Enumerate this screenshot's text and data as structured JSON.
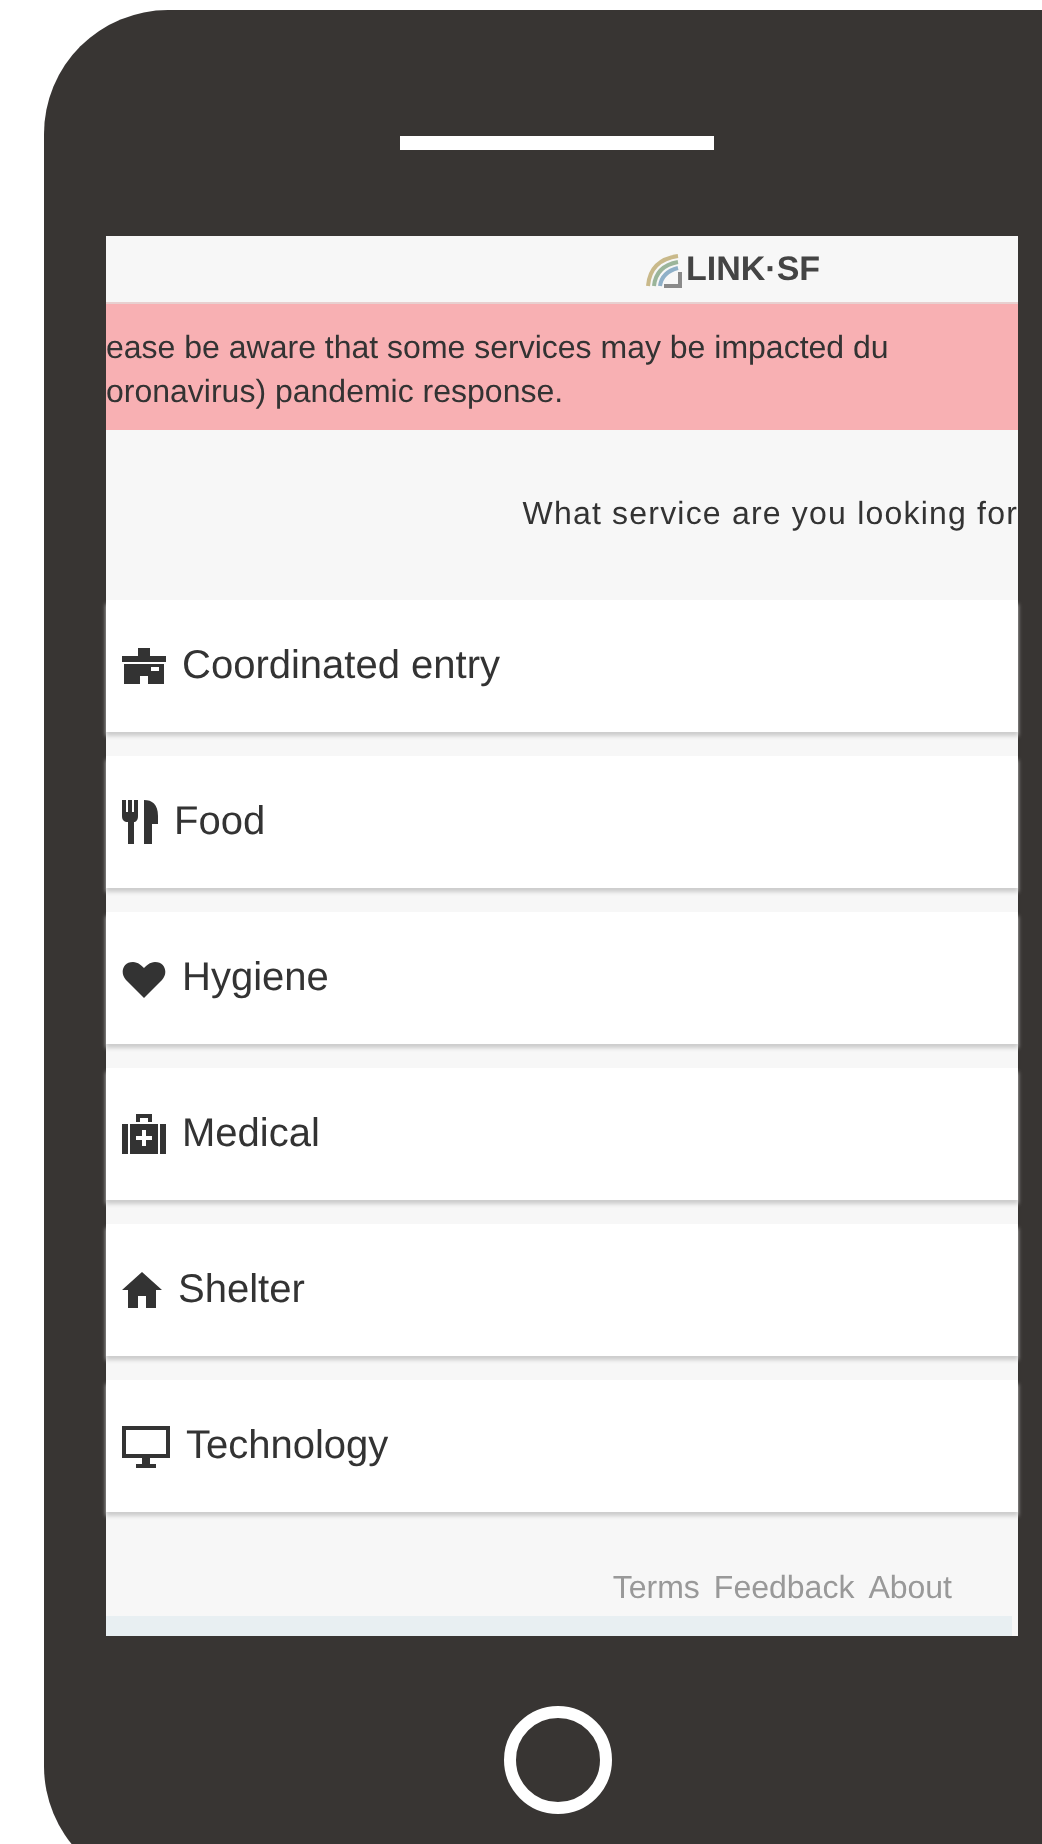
{
  "header": {
    "logo_text": "LINK·SF"
  },
  "alert": {
    "lines": [
      "ease be aware that some services may be impacted du",
      "oronavirus) pandemic response."
    ]
  },
  "prompt": "What service are you looking for",
  "services": [
    {
      "kind": "entry",
      "label": "Coordinated entry"
    },
    {
      "kind": "food",
      "label": "Food"
    },
    {
      "kind": "hygiene",
      "label": "Hygiene"
    },
    {
      "kind": "medical",
      "label": "Medical"
    },
    {
      "kind": "shelter",
      "label": "Shelter"
    },
    {
      "kind": "technology",
      "label": "Technology"
    }
  ],
  "footer_links": [
    "Terms",
    "Feedback",
    "About"
  ]
}
